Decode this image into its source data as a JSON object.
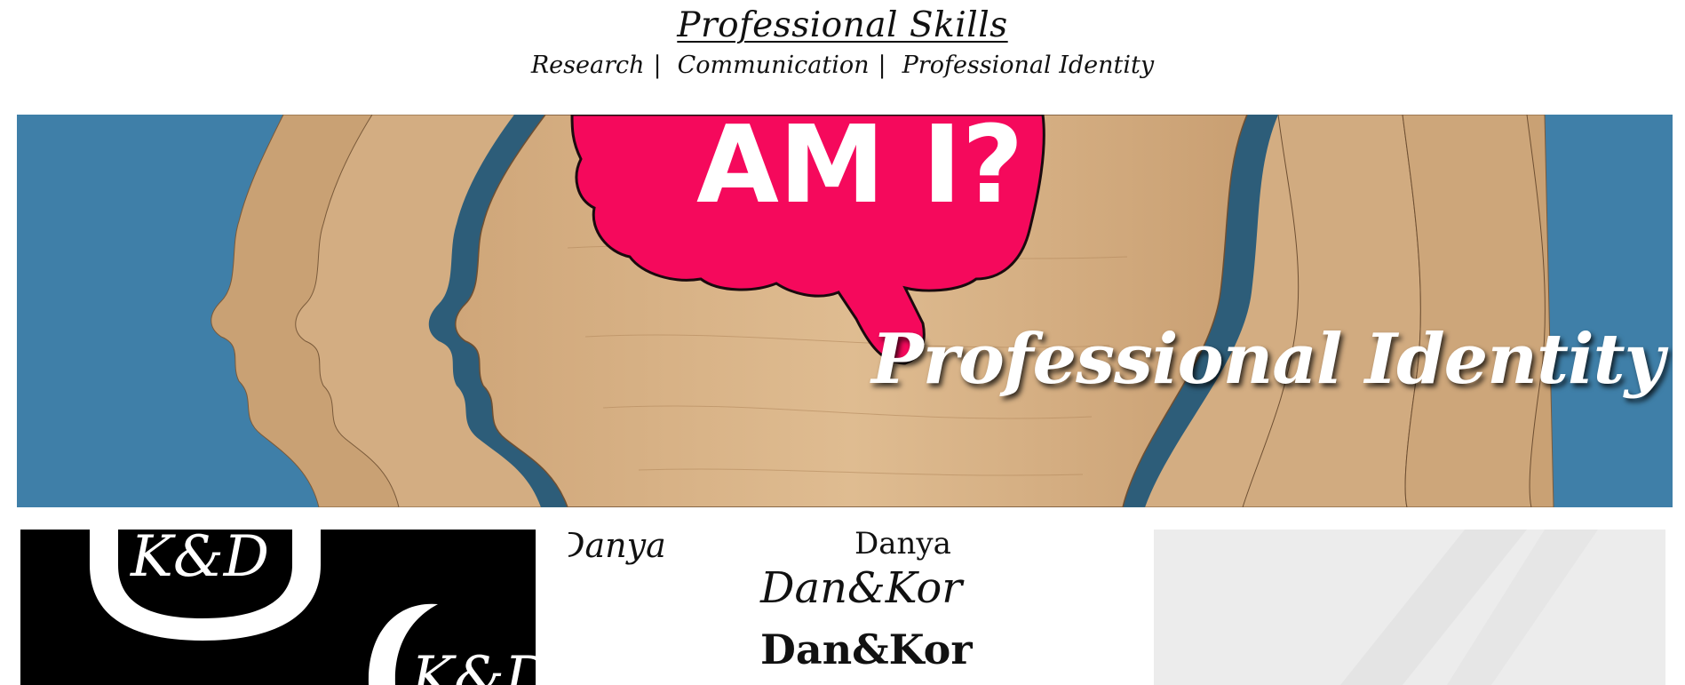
{
  "header": {
    "title": "Professional Skills",
    "nav": [
      {
        "label": "Research",
        "sep": "|"
      },
      {
        "label": "Communication",
        "sep": "|"
      },
      {
        "label": "Professional Identity"
      }
    ]
  },
  "hero": {
    "title": "Professional Identity",
    "bubble_text": "AM I?",
    "colors": {
      "background": "#3f7fa8",
      "wood": "#d9b487",
      "bubble": "#f5095c"
    }
  },
  "gallery": {
    "logo_card": {
      "monogram": "K&D",
      "monogram_partial": "K&D"
    },
    "font_card": {
      "sample_partial": "Danya",
      "sample_top": "Danya",
      "sample_middle": "Dan&Kor",
      "sample_bottom": "Dan&Kor"
    }
  }
}
